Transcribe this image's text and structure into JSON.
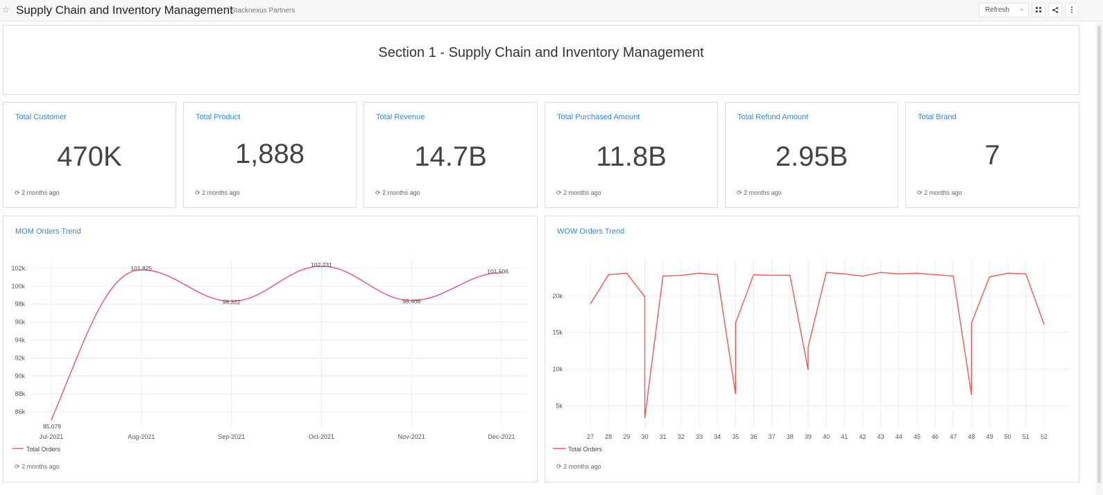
{
  "header": {
    "title": "Supply Chain and Inventory Management",
    "org": "Stacknexus Partners",
    "refresh_label": "Refresh",
    "icons": [
      "star-icon",
      "chevron-down-icon",
      "fullscreen-icon",
      "share-icon",
      "more-vertical-icon"
    ]
  },
  "section": {
    "title": "Section 1 - Supply Chain and Inventory Management"
  },
  "kpis": [
    {
      "title": "Total Customer",
      "value": "470K",
      "updated": "2 months ago"
    },
    {
      "title": "Total Product",
      "value": "1,888",
      "updated": "2 months ago"
    },
    {
      "title": "Total Revenue",
      "value": "14.7B",
      "updated": "2 months ago"
    },
    {
      "title": "Total Purchased Amount",
      "value": "11.8B",
      "updated": "2 months ago"
    },
    {
      "title": "Total Refund Amount",
      "value": "2.95B",
      "updated": "2 months ago"
    },
    {
      "title": "Total Brand",
      "value": "7",
      "updated": "2 months ago"
    }
  ],
  "charts": {
    "mom": {
      "title": "MOM Orders Trend",
      "updated": "2 months ago"
    },
    "wow": {
      "title": "WOW Orders Trend",
      "updated": "2 months ago"
    }
  },
  "colors": {
    "accent": "#2e8ade",
    "mom_line": "#f0506e",
    "wow_line": "#f25553"
  },
  "chart_data": [
    {
      "type": "line",
      "title": "MOM Orders Trend",
      "categories": [
        "Jul-2021",
        "Aug-2021",
        "Sep-2021",
        "Oct-2021",
        "Nov-2021",
        "Dec-2021"
      ],
      "series": [
        {
          "name": "Total Orders",
          "values": [
            85079,
            101825,
            98322,
            102231,
            98408,
            101506
          ],
          "labels": [
            "85,079",
            "101,825",
            "98,322",
            "102,231",
            "98,408",
            "101,506"
          ]
        }
      ],
      "y_ticks": [
        "86k",
        "88k",
        "90k",
        "92k",
        "94k",
        "96k",
        "98k",
        "100k",
        "102k"
      ],
      "y_tick_values": [
        86000,
        88000,
        90000,
        92000,
        94000,
        96000,
        98000,
        100000,
        102000
      ],
      "ylim": [
        85000,
        103000
      ],
      "smooth": true,
      "grid": true,
      "legend": "bottom-left"
    },
    {
      "type": "line",
      "title": "WOW Orders Trend",
      "x_points": [
        27,
        28,
        29,
        30,
        30,
        31,
        32,
        33,
        34,
        35,
        35,
        36,
        37,
        38,
        39,
        39,
        40,
        41,
        42,
        43,
        44,
        45,
        46,
        47,
        48,
        48,
        49,
        50,
        51,
        52
      ],
      "categories": [
        "27",
        "28",
        "29",
        "30",
        "31",
        "32",
        "33",
        "34",
        "35",
        "36",
        "37",
        "38",
        "39",
        "40",
        "41",
        "42",
        "43",
        "44",
        "45",
        "46",
        "47",
        "48",
        "49",
        "50",
        "51",
        "52"
      ],
      "series": [
        {
          "name": "Total Orders",
          "values": [
            18900,
            22900,
            23100,
            19900,
            3300,
            22700,
            22800,
            23100,
            22900,
            6600,
            16300,
            22900,
            22800,
            22800,
            9900,
            13000,
            23200,
            23000,
            22700,
            23200,
            23000,
            23100,
            22900,
            22700,
            6500,
            16300,
            22600,
            23100,
            23000,
            16100
          ]
        }
      ],
      "y_ticks": [
        "5k",
        "10k",
        "15k",
        "20k"
      ],
      "y_tick_values": [
        5000,
        10000,
        15000,
        20000
      ],
      "ylim": [
        2000,
        25000
      ],
      "grid": true,
      "legend": "bottom-left"
    }
  ]
}
